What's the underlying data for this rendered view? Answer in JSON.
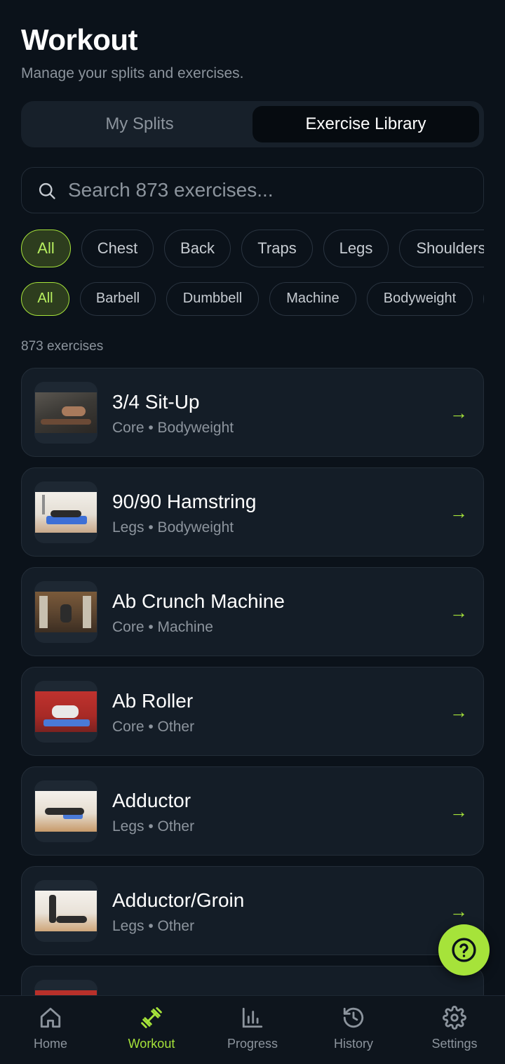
{
  "header": {
    "title": "Workout",
    "subtitle": "Manage your splits and exercises."
  },
  "tabs": {
    "my_splits": "My Splits",
    "exercise_library": "Exercise Library",
    "selected": "Exercise Library"
  },
  "search": {
    "placeholder": "Search 873 exercises..."
  },
  "muscle_filters": [
    "All",
    "Chest",
    "Back",
    "Traps",
    "Legs",
    "Shoulders"
  ],
  "equipment_filters": [
    "All",
    "Barbell",
    "Dumbbell",
    "Machine",
    "Bodyweight"
  ],
  "selected_muscle_filter": "All",
  "selected_equipment_filter": "All",
  "count_label": "873 exercises",
  "exercises": [
    {
      "name": "3/4 Sit-Up",
      "meta": "Core • Bodyweight",
      "arrow": "→"
    },
    {
      "name": "90/90 Hamstring",
      "meta": "Legs • Bodyweight",
      "arrow": "→"
    },
    {
      "name": "Ab Crunch Machine",
      "meta": "Core • Machine",
      "arrow": "→"
    },
    {
      "name": "Ab Roller",
      "meta": "Core • Other",
      "arrow": "→"
    },
    {
      "name": "Adductor",
      "meta": "Legs • Other",
      "arrow": "→"
    },
    {
      "name": "Adductor/Groin",
      "meta": "Legs • Other",
      "arrow": "→"
    }
  ],
  "bottom_nav": [
    {
      "label": "Home",
      "icon": "home-icon"
    },
    {
      "label": "Workout",
      "icon": "dumbbell-icon"
    },
    {
      "label": "Progress",
      "icon": "bar-chart-icon"
    },
    {
      "label": "History",
      "icon": "history-icon"
    },
    {
      "label": "Settings",
      "icon": "gear-icon"
    }
  ],
  "active_nav": "Workout",
  "colors": {
    "background": "#0b121a",
    "card": "#141d27",
    "accent": "#a6e33a",
    "muted_text": "#8c949d"
  }
}
